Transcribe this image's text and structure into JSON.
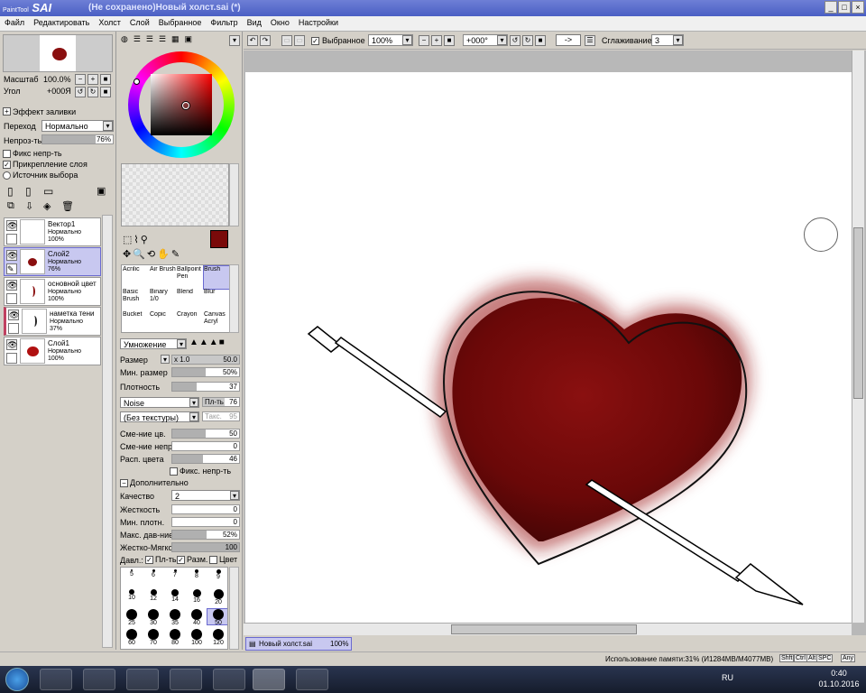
{
  "window": {
    "logo": "SAI",
    "logo_sub": "PaintTool",
    "title": "(Не сохранено)Новый холст.sai (*)",
    "min": "_",
    "max": "□",
    "close": "×"
  },
  "menu": [
    "Файл",
    "Редактировать",
    "Холст",
    "Слой",
    "Выбранное",
    "Фильтр",
    "Вид",
    "Окно",
    "Настройки"
  ],
  "navigator": {
    "zoom_label": "Масштаб",
    "zoom_value": "100.0%",
    "angle_label": "Угол",
    "angle_value": "+000Я"
  },
  "fill_effect": {
    "header": "Эффект заливки",
    "blend_label": "Переход",
    "blend_value": "Нормально",
    "opacity_label": "Непроз-ть",
    "opacity_value": "76%",
    "opacity_level": 0.76
  },
  "layer_checks": {
    "fix_opacity": "Фикс непр-ть",
    "clip": "Прикрепление слоя",
    "source": "Источник выбора"
  },
  "layers": [
    {
      "name": "Вектор1",
      "mode": "Нормально",
      "opacity": "100%",
      "selected": false
    },
    {
      "name": "Слой2",
      "mode": "Нормально",
      "opacity": "76%",
      "selected": true
    },
    {
      "name": "основной цвет",
      "mode": "Нормально",
      "opacity": "100%",
      "selected": false
    },
    {
      "name": "наметка тени",
      "mode": "Нормально",
      "opacity": "37%",
      "selected": false
    },
    {
      "name": "Слой1",
      "mode": "Нормально",
      "opacity": "100%",
      "selected": false
    }
  ],
  "colors": {
    "primary": "#7a0a0a",
    "accent": "#5a6cd0",
    "selection": "#c8c8f0"
  },
  "brushes": [
    [
      "Acrilic",
      "Air Brush",
      "Ballpoint Pen",
      "Brush"
    ],
    [
      "Basic Brush",
      "Binary 1/0",
      "Blend",
      "Blur"
    ],
    [
      "Bucket",
      "Copic",
      "Crayon",
      "Canvas Acryl"
    ]
  ],
  "brush_settings": {
    "blend_mode": "Умножение",
    "size_label": "Размер",
    "size_mult": "x 1.0",
    "size_value": "50.0",
    "min_size_label": "Мин. размер",
    "min_size_value": "50%",
    "min_size_level": 0.5,
    "density_label": "Плотность",
    "density_value": "37",
    "density_level": 0.37,
    "texture_value": "Noise",
    "texture_strength_label": "Пл-ть",
    "texture_strength_value": "76",
    "paper_value": "(Без текстуры)",
    "paper_strength_label": "Такс.",
    "paper_strength_value": "95",
    "mix_color_label": "Сме-ние цв.",
    "mix_color_value": "50",
    "mix_color_level": 0.5,
    "mix_opacity_label": "Сме-ние непр.",
    "mix_opacity_value": "0",
    "mix_opacity_level": 0,
    "spread_label": "Расп. цвета",
    "spread_value": "46",
    "spread_level": 0.46,
    "fix_opacity": "Фикс. непр-ть",
    "advanced_header": "Дополнительно",
    "quality_label": "Качество",
    "quality_value": "2",
    "hardness_label": "Жесткость",
    "hardness_value": "0",
    "min_density_label": "Мин. плотн.",
    "min_density_value": "0",
    "max_pressure_label": "Макс. дав-ние",
    "max_pressure_value": "52%",
    "max_pressure_level": 0.52,
    "soft_hard_label": "Жестко-Мягко",
    "soft_hard_value": "100",
    "soft_hard_level": 1,
    "pressure_label": "Давл.:",
    "pressure_density": "Пл-ть",
    "pressure_size": "Разм.",
    "pressure_color": "Цвет"
  },
  "brush_sizes": [
    "5",
    "6",
    "7",
    "8",
    "9",
    "10",
    "12",
    "14",
    "16",
    "20",
    "25",
    "30",
    "35",
    "40",
    "50",
    "60",
    "70",
    "80",
    "100",
    "120"
  ],
  "toolbar": {
    "selection_label": "Выбранное",
    "zoom": "100%",
    "angle": "+000°",
    "arrow": "->",
    "smoothing_label": "Сглаживание",
    "smoothing_value": "3"
  },
  "doc_tab": {
    "name": "Новый холст.sai",
    "zoom": "100%"
  },
  "status": {
    "memory": "Использование памяти:31% (И1284MB/M4077MB)",
    "keys": [
      "Shft",
      "Ctrl",
      "Alt",
      "SPC",
      "Any"
    ]
  },
  "taskbar": {
    "lang": "RU",
    "time": "0:40",
    "date": "01.10.2016"
  }
}
